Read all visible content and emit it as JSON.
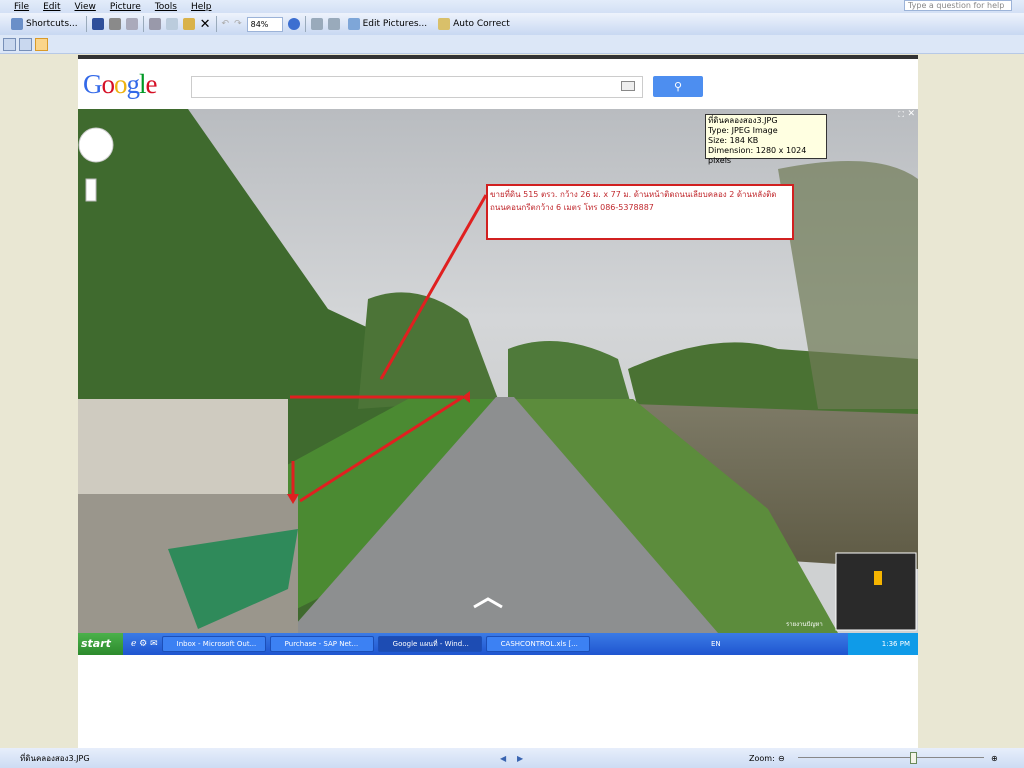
{
  "menu": [
    "File",
    "Edit",
    "View",
    "Picture",
    "Tools",
    "Help"
  ],
  "help_placeholder": "Type a question for help",
  "toolbar": {
    "shortcuts": "Shortcuts...",
    "zoom": "84%",
    "edit_pictures": "Edit Pictures...",
    "auto_correct": "Auto Correct"
  },
  "google": {
    "logo": "Google",
    "search_value": ""
  },
  "tooltip": {
    "name": "ที่ดินคลองสอง3.JPG",
    "type": "Type: JPEG Image",
    "size": "Size: 184 KB",
    "dimension": "Dimension: 1280 x 1024 pixels"
  },
  "note": {
    "line1": "ขายที่ดิน 515 ตรว. กว้าง 26 ม. x 77 ม. ด้านหน้าติดถนนเลียบคลอง 2 ด้านหลังติด",
    "line2": "ถนนคอนกรีตกว้าง 6 เมตร  โทร 086-5378887"
  },
  "report": "รายงานปัญหา",
  "taskbar": {
    "start": "start",
    "tasks": [
      "Inbox - Microsoft Out...",
      "Purchase - SAP Net...",
      "Google แผนที่ - Wind...",
      "CASHCONTROL.xls [..."
    ],
    "lang": "EN",
    "time": "1:36 PM"
  },
  "status": {
    "filename": "ที่ดินคลองสอง3.JPG",
    "zoom_label": "Zoom:",
    "zoom_level": 0.62
  }
}
